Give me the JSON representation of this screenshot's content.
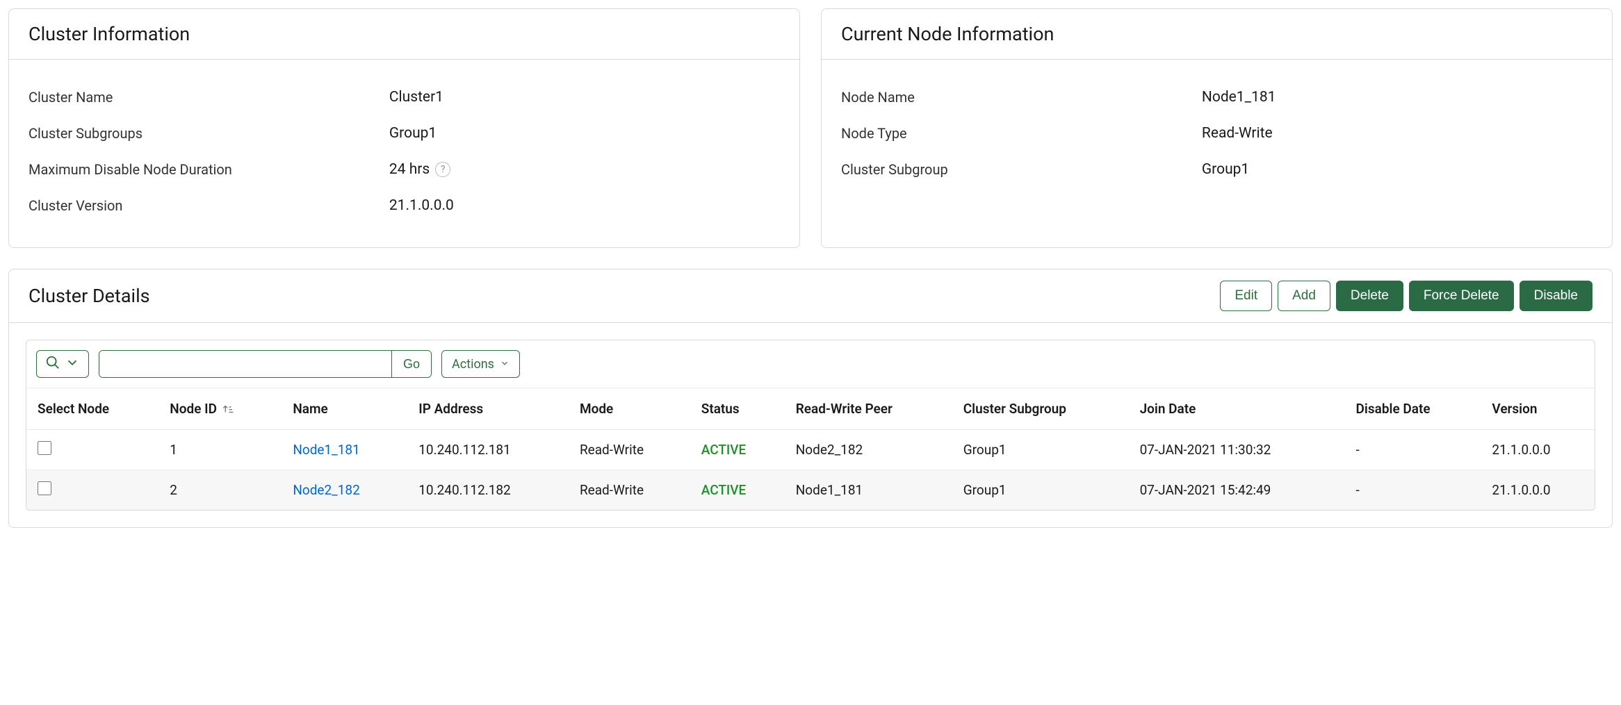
{
  "cluster_info": {
    "title": "Cluster Information",
    "rows": [
      {
        "label": "Cluster Name",
        "value": "Cluster1",
        "help": false
      },
      {
        "label": "Cluster Subgroups",
        "value": "Group1",
        "help": false
      },
      {
        "label": "Maximum Disable Node Duration",
        "value": "24 hrs",
        "help": true
      },
      {
        "label": "Cluster Version",
        "value": "21.1.0.0.0",
        "help": false
      }
    ]
  },
  "node_info": {
    "title": "Current Node Information",
    "rows": [
      {
        "label": "Node Name",
        "value": "Node1_181"
      },
      {
        "label": "Node Type",
        "value": "Read-Write"
      },
      {
        "label": "Cluster Subgroup",
        "value": "Group1"
      }
    ]
  },
  "details": {
    "title": "Cluster Details",
    "buttons": {
      "edit": "Edit",
      "add": "Add",
      "delete": "Delete",
      "force_delete": "Force Delete",
      "disable": "Disable"
    },
    "toolbar": {
      "go": "Go",
      "actions": "Actions",
      "search_value": ""
    },
    "columns": [
      "Select Node",
      "Node ID",
      "Name",
      "IP Address",
      "Mode",
      "Status",
      "Read-Write Peer",
      "Cluster Subgroup",
      "Join Date",
      "Disable Date",
      "Version"
    ],
    "rows": [
      {
        "node_id": "1",
        "name": "Node1_181",
        "ip": "10.240.112.181",
        "mode": "Read-Write",
        "status": "ACTIVE",
        "peer": "Node2_182",
        "subgroup": "Group1",
        "join_date": "07-JAN-2021 11:30:32",
        "disable_date": "-",
        "version": "21.1.0.0.0"
      },
      {
        "node_id": "2",
        "name": "Node2_182",
        "ip": "10.240.112.182",
        "mode": "Read-Write",
        "status": "ACTIVE",
        "peer": "Node1_181",
        "subgroup": "Group1",
        "join_date": "07-JAN-2021 15:42:49",
        "disable_date": "-",
        "version": "21.1.0.0.0"
      }
    ]
  },
  "colors": {
    "accent": "#2e6e3a",
    "link": "#0066cc",
    "active": "#1a8f2a"
  }
}
